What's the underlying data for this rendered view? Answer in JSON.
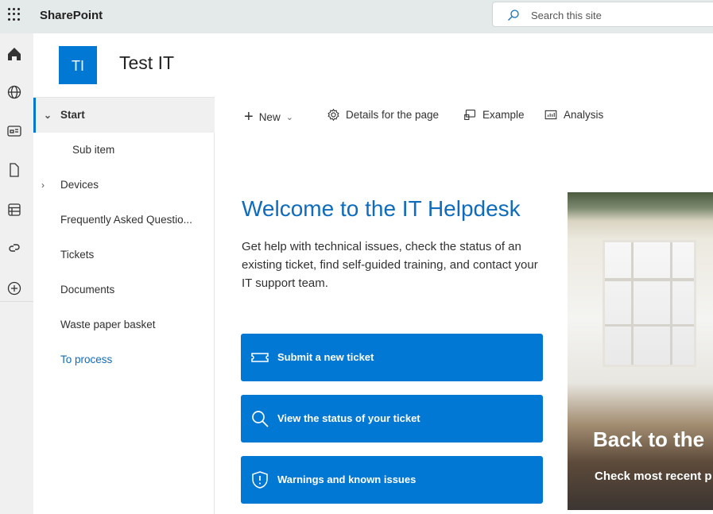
{
  "app": {
    "name": "SharePoint",
    "search_placeholder": "Search this site"
  },
  "site": {
    "initials": "TI",
    "title": "Test IT"
  },
  "nav": [
    {
      "label": "Start"
    },
    {
      "label": "Sub item"
    },
    {
      "label": "Devices"
    },
    {
      "label": "Frequently Asked Questio..."
    },
    {
      "label": "Tickets"
    },
    {
      "label": "Documents"
    },
    {
      "label": "Waste paper basket"
    },
    {
      "label": "To process"
    }
  ],
  "commands": {
    "new": "New",
    "details": "Details for the page",
    "example": "Example",
    "analysis": "Analysis"
  },
  "main": {
    "heading": "Welcome to the IT Helpdesk",
    "description": "Get help with technical issues, check the status of an existing ticket, find self-guided training, and contact your IT support team.",
    "buttons": [
      {
        "label": "Submit a new ticket"
      },
      {
        "label": "View the status of your ticket"
      },
      {
        "label": "Warnings and known issues"
      }
    ]
  },
  "hero": {
    "title": "Back to the",
    "subtitle": "Check most recent p"
  },
  "colors": {
    "accent": "#0078d4",
    "link": "#0f6cbd"
  }
}
